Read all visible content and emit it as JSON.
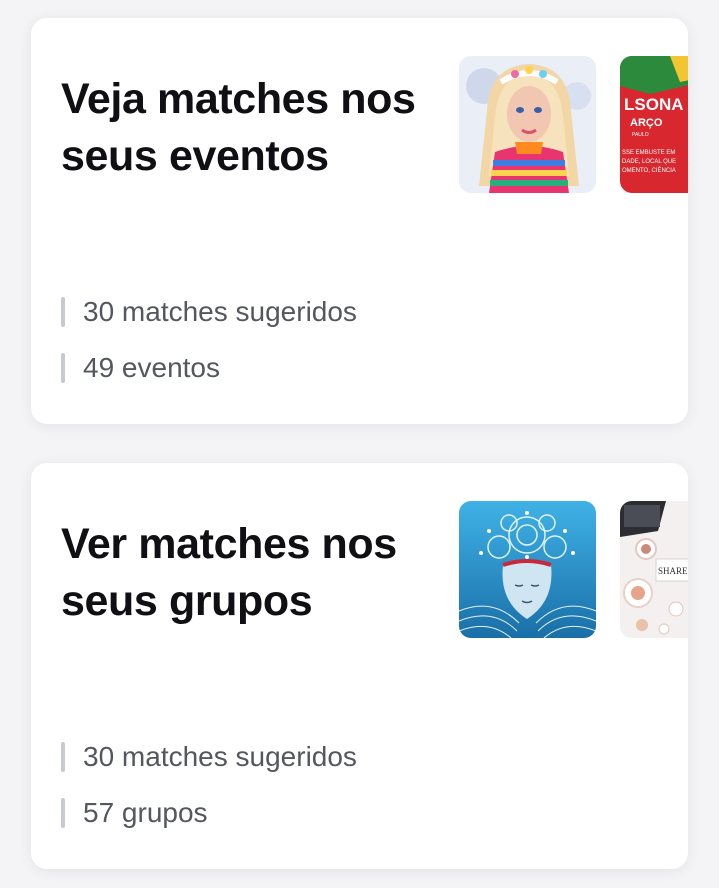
{
  "cards": [
    {
      "title_line1": "Veja matches nos",
      "title_line2": "seus eventos",
      "stats": [
        "30 matches sugeridos",
        "49 eventos"
      ],
      "thumb2": {
        "headline": "LSONA",
        "sub": "ARÇO",
        "small": "PAULO",
        "lines": [
          "SSE EMBUSTE EM",
          "DADE, LOCAL QUE",
          "OMENTO, CIÊNCIA"
        ]
      }
    },
    {
      "title_line1": "Ver matches nos",
      "title_line2": "seus grupos",
      "stats": [
        "30 matches sugeridos",
        "57 grupos"
      ],
      "thumb2": {
        "headline": "SHARE YO"
      }
    }
  ]
}
